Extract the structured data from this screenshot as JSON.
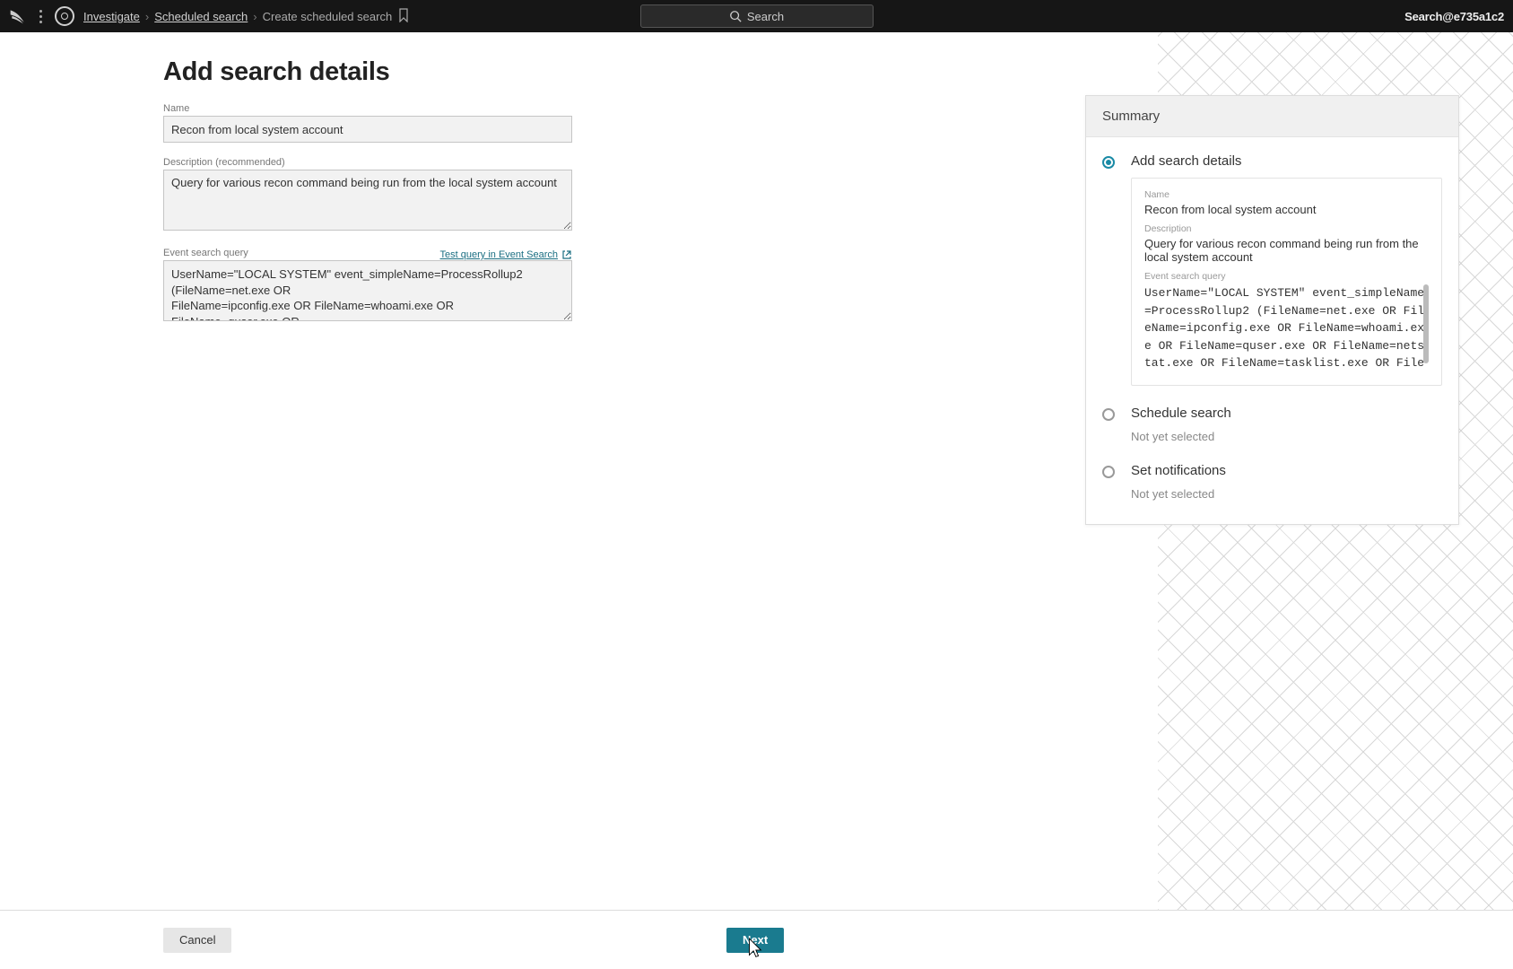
{
  "topbar": {
    "breadcrumb": {
      "l1": "Investigate",
      "l2": "Scheduled search",
      "current": "Create scheduled search"
    },
    "search_placeholder": "Search",
    "user": "Search@e735a1c2"
  },
  "form": {
    "title": "Add search details",
    "name_label": "Name",
    "name_value": "Recon from local system account",
    "desc_label": "Description (recommended)",
    "desc_value": "Query for various recon command being run from the local system account",
    "query_label": "Event search query",
    "test_link": "Test query in Event Search",
    "query_value": "UserName=\"LOCAL SYSTEM\" event_simpleName=ProcessRollup2 (FileName=net.exe OR\nFileName=ipconfig.exe OR FileName=whoami.exe OR FileName=quser.exe OR\nFileName=netstat.exe OR FileName=tasklist.exe OR FileName=at.exe) | dedup aid | table"
  },
  "summary": {
    "header": "Summary",
    "step1_title": "Add search details",
    "s_name_label": "Name",
    "s_name_value": "Recon from local system account",
    "s_desc_label": "Description",
    "s_desc_value": "Query for various recon command being run from the local system account",
    "s_query_label": "Event search query",
    "s_query_value": "UserName=\"LOCAL SYSTEM\" event_simpleName=ProcessRollup2 (FileName=net.exe OR FileName=ipconfig.exe OR FileName=whoami.exe OR FileName=quser.exe OR FileName=netstat.exe OR FileName=tasklist.exe OR FileName=at.exe) | dedup aid | table C",
    "step2_title": "Schedule search",
    "step2_status": "Not yet selected",
    "step3_title": "Set notifications",
    "step3_status": "Not yet selected"
  },
  "footer": {
    "cancel": "Cancel",
    "next": "Next"
  }
}
